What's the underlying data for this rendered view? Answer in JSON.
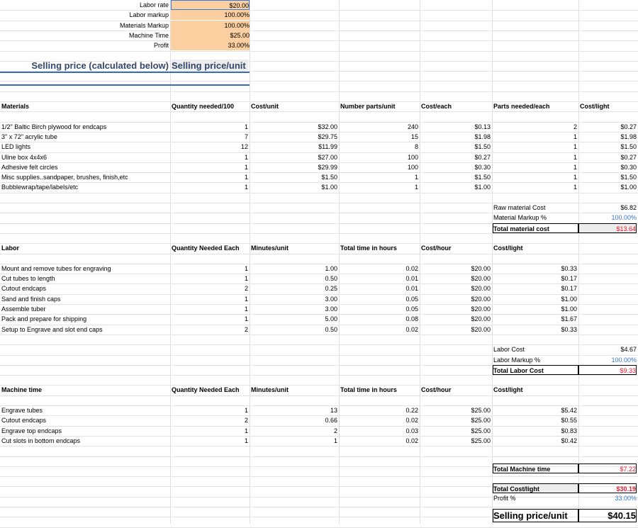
{
  "inputs": [
    {
      "label": "Labor rate",
      "value": "$20.00"
    },
    {
      "label": "Labor markup",
      "value": "100.00%"
    },
    {
      "label": "Materials Markup",
      "value": "100.00%"
    },
    {
      "label": "Machine Time",
      "value": "$25.00"
    },
    {
      "label": "Profit",
      "value": "33.00%"
    }
  ],
  "summary_header": {
    "left": "Selling price (calculated below)",
    "right": "Selling price/unit"
  },
  "materials": {
    "headers": [
      "Materials",
      "Quantity needed/100",
      "Cost/unit",
      "Number parts/unit",
      "Cost/each",
      "Parts needed/each",
      "Cost/light"
    ],
    "rows": [
      [
        "1/2\" Baltic Birch plywood for endcaps",
        "1",
        "$32.00",
        "240",
        "$0.13",
        "2",
        "$0.27"
      ],
      [
        "3\" x 72\" acrylic tube",
        "7",
        "$29.75",
        "15",
        "$1.98",
        "1",
        "$1.98"
      ],
      [
        "LED lights",
        "12",
        "$11.99",
        "8",
        "$1.50",
        "1",
        "$1.50"
      ],
      [
        "Uline box 4x4x6",
        "1",
        "$27.00",
        "100",
        "$0.27",
        "1",
        "$0.27"
      ],
      [
        "Adhesive felt circles",
        "1",
        "$29.99",
        "100",
        "$0.30",
        "1",
        "$0.30"
      ],
      [
        "Misc supplies..sandpaper, brushes, finish,etc",
        "1",
        "$1.50",
        "1",
        "$1.50",
        "1",
        "$1.50"
      ],
      [
        "Bubblewrap/tape/labels/etc",
        "1",
        "$1.00",
        "1",
        "$1.00",
        "1",
        "$1.00"
      ]
    ],
    "totals": [
      {
        "label": "Raw material Cost",
        "value": "$6.82"
      },
      {
        "label": "Material Markup %",
        "value": "100.00%"
      },
      {
        "label": "Total material cost",
        "value": "$13.64"
      }
    ]
  },
  "labor": {
    "headers": [
      "Labor",
      "Quantity Needed Each",
      "Minutes/unit",
      "Total time in hours",
      "Cost/hour",
      "Cost/light"
    ],
    "rows": [
      [
        "Mount and remove tubes for engraving",
        "1",
        "1.00",
        "0.02",
        "$20.00",
        "$0.33"
      ],
      [
        "Cut tubes to length",
        "1",
        "0.50",
        "0.01",
        "$20.00",
        "$0.17"
      ],
      [
        "Cutout endcaps",
        "2",
        "0.25",
        "0.01",
        "$20.00",
        "$0.17"
      ],
      [
        "Sand and finish caps",
        "1",
        "3.00",
        "0.05",
        "$20.00",
        "$1.00"
      ],
      [
        "Assemble tuber",
        "1",
        "3.00",
        "0.05",
        "$20.00",
        "$1.00"
      ],
      [
        "Pack and prepare for shipping",
        "1",
        "5.00",
        "0.08",
        "$20.00",
        "$1.67"
      ],
      [
        "Setup to Engrave and slot end caps",
        "2",
        "0.50",
        "0.02",
        "$20.00",
        "$0.33"
      ]
    ],
    "totals": [
      {
        "label": "Labor Cost",
        "value": "$4.67"
      },
      {
        "label": "Labor Markup %",
        "value": "100.00%"
      },
      {
        "label": "Total Labor Cost",
        "value": "$9.33"
      }
    ]
  },
  "machine": {
    "headers": [
      "Machine time",
      "Quantity Needed Each",
      "Minutes/unit",
      "Total time in hours",
      "Cost/hour",
      "Cost/light"
    ],
    "rows": [
      [
        "Engrave tubes",
        "1",
        "13",
        "0.22",
        "$25.00",
        "$5.42"
      ],
      [
        "Cutout endcaps",
        "2",
        "0.66",
        "0.02",
        "$25.00",
        "$0.55"
      ],
      [
        "Engrave top endcaps",
        "1",
        "2",
        "0.03",
        "$25.00",
        "$0.83"
      ],
      [
        "Cut slots in bottom endcaps",
        "1",
        "1",
        "0.02",
        "$25.00",
        "$0.42"
      ]
    ],
    "total": {
      "label": "Total Machine time",
      "value": "$7.22"
    }
  },
  "final": {
    "total_cost": {
      "label": "Total Cost/light",
      "value": "$30.19"
    },
    "profit": {
      "label": "Profit %",
      "value": "33.00%"
    },
    "selling": {
      "label": "Selling price/unit",
      "value": "$40.15"
    }
  },
  "colors": {
    "input_fill": "#fbcfa0",
    "red": "#e8192c",
    "blue": "#3876d0",
    "title": "#33476b"
  }
}
